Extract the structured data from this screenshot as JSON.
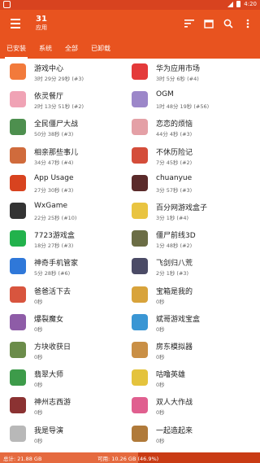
{
  "status": {
    "time": "4:20"
  },
  "app": {
    "count": "31",
    "subtitle": "应用"
  },
  "tabs": [
    "已安装",
    "系统",
    "全部",
    "已卸载"
  ],
  "apps": [
    {
      "name": "游戏中心",
      "meta": "3时 29分 29秒 (#3)",
      "icon": "game-center-icon",
      "color": "#f27a3b"
    },
    {
      "name": "华为应用市场",
      "meta": "3时 5分 6秒 (#4)",
      "icon": "huawei-appgallery-icon",
      "color": "#e43a3a"
    },
    {
      "name": "依灵餐厅",
      "meta": "2时 13分 51秒 (#2)",
      "icon": "yiling-restaurant-icon",
      "color": "#f0a3b5"
    },
    {
      "name": "OGM",
      "meta": "1时 48分 19秒 (#56)",
      "icon": "ogm-icon",
      "color": "#9c87c9"
    },
    {
      "name": "全民僵尸大战",
      "meta": "50分 38秒 (#3)",
      "icon": "zombie-war-icon",
      "color": "#4d8f4e"
    },
    {
      "name": "恋恋的烦恼",
      "meta": "44分 4秒 (#3)",
      "icon": "love-trouble-icon",
      "color": "#e4a0a6"
    },
    {
      "name": "相亲那些事儿",
      "meta": "34分 47秒 (#4)",
      "icon": "dating-stories-icon",
      "color": "#d06b3c"
    },
    {
      "name": "不休历险记",
      "meta": "7分 45秒 (#2)",
      "icon": "adventure-icon",
      "color": "#d44d3a"
    },
    {
      "name": "App Usage",
      "meta": "27分 30秒 (#3)",
      "icon": "app-usage-icon",
      "color": "#d8431f"
    },
    {
      "name": "chuanyue",
      "meta": "3分 57秒 (#3)",
      "icon": "chuanyue-icon",
      "color": "#5a2a2a"
    },
    {
      "name": "WxGame",
      "meta": "22分 25秒 (#10)",
      "icon": "wxgame-icon",
      "color": "#333333"
    },
    {
      "name": "百分网游戏盒子",
      "meta": "3分 1秒 (#4)",
      "icon": "baifen-gamebox-icon",
      "color": "#e9c441"
    },
    {
      "name": "7723游戏盒",
      "meta": "18分 27秒 (#3)",
      "icon": "7723-gamebox-icon",
      "color": "#22b24c"
    },
    {
      "name": "僵尸前线3D",
      "meta": "1分 48秒 (#2)",
      "icon": "zombie-frontline-icon",
      "color": "#6b6d45"
    },
    {
      "name": "神奇手机管家",
      "meta": "5分 28秒 (#6)",
      "icon": "phone-manager-icon",
      "color": "#2f78d9"
    },
    {
      "name": "飞剑归八荒",
      "meta": "2分 1秒 (#3)",
      "icon": "flying-sword-icon",
      "color": "#4b4b66"
    },
    {
      "name": "爸爸活下去",
      "meta": "0秒",
      "icon": "dad-survive-icon",
      "color": "#d8553e"
    },
    {
      "name": "宝箱是我的",
      "meta": "0秒",
      "icon": "treasure-chest-icon",
      "color": "#d8a33b"
    },
    {
      "name": "爆裂魔女",
      "meta": "0秒",
      "icon": "burst-witch-icon",
      "color": "#8e5ca7"
    },
    {
      "name": "斌哥游戏宝盒",
      "meta": "0秒",
      "icon": "binge-gamebox-icon",
      "color": "#3a96d4"
    },
    {
      "name": "方块收获日",
      "meta": "0秒",
      "icon": "block-harvest-icon",
      "color": "#6b8c4a"
    },
    {
      "name": "房东模拟器",
      "meta": "0秒",
      "icon": "landlord-sim-icon",
      "color": "#c98f45"
    },
    {
      "name": "翡翠大师",
      "meta": "0秒",
      "icon": "jade-master-icon",
      "color": "#3d9b4a"
    },
    {
      "name": "咕噜英雄",
      "meta": "0秒",
      "icon": "gulu-hero-icon",
      "color": "#e4c33d"
    },
    {
      "name": "神州志西游",
      "meta": "0秒",
      "icon": "journey-west-icon",
      "color": "#8b3232"
    },
    {
      "name": "双人大作战",
      "meta": "0秒",
      "icon": "duo-battle-icon",
      "color": "#e05f8f"
    },
    {
      "name": "我是导演",
      "meta": "0秒",
      "icon": "director-icon",
      "color": "#b8b8b8"
    },
    {
      "name": "一起造起来",
      "meta": "0秒",
      "icon": "build-together-icon",
      "color": "#b07a3a"
    }
  ],
  "footer": {
    "total": "总计: 21.88 GB",
    "available": "可用: 10.26 GB (46.9%)",
    "used_fraction": 0.531
  }
}
